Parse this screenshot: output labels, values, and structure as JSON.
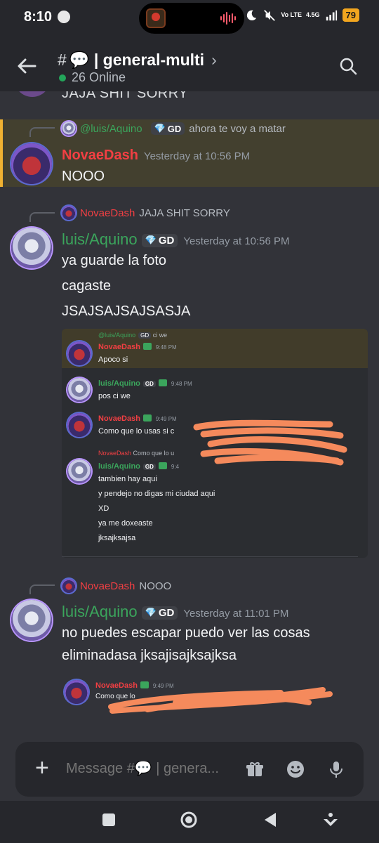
{
  "status": {
    "time": "8:10",
    "network": "4.5G",
    "lte": "Vo LTE",
    "battery": "79"
  },
  "header": {
    "channel_name": "💬 | general-multi",
    "online": "26 Online"
  },
  "cutoff_text": "JAJA SHIT SORRY",
  "messages": [
    {
      "reply_user": "@luis/Aquino",
      "reply_tag": "GD",
      "reply_text": "ahora te voy a matar",
      "author": "NovaeDash",
      "timestamp": "Yesterday at 10:56 PM",
      "lines": [
        "NOOO"
      ]
    },
    {
      "reply_user": "NovaeDash",
      "reply_text": "JAJA SHIT SORRY",
      "author": "luis/Aquino",
      "tag": "GD",
      "timestamp": "Yesterday at 10:56 PM",
      "lines": [
        "ya guarde la foto",
        "cagaste",
        "JSAJSAJSAJSASJA"
      ]
    },
    {
      "reply_user": "NovaeDash",
      "reply_text": "NOOO",
      "author": "luis/Aquino",
      "tag": "GD",
      "timestamp": "Yesterday at 11:01 PM",
      "lines": [
        "no puedes escapar puedo ver las cosas",
        "eliminadasa jksajisajksajksa"
      ]
    }
  ],
  "screenshot": {
    "m1": {
      "reply_user": "@luis/Aquino",
      "reply_tag": "GD",
      "reply_text": "ci we",
      "author": "NovaeDash",
      "time": "9:48 PM",
      "text": "Apoco si"
    },
    "m2": {
      "author": "luis/Aquino",
      "tag": "GD",
      "time": "9:48 PM",
      "text": "pos ci we"
    },
    "m3": {
      "author": "NovaeDash",
      "time": "9:49 PM",
      "text": "Como que lo usas si c"
    },
    "m4": {
      "reply_user": "NovaeDash",
      "reply_text": "Como que lo u",
      "author": "luis/Aquino",
      "tag": "GD",
      "time": "9:4",
      "lines": [
        "tambien hay aqui",
        "y pendejo no digas mi ciudad aqui",
        "XD",
        "ya me doxeaste",
        "jksajksajsa"
      ]
    }
  },
  "deleted_preview": {
    "author": "NovaeDash",
    "time": "9:49 PM",
    "text": "Como que lo"
  },
  "composer": {
    "placeholder": "Message #💬 | genera..."
  },
  "colors": {
    "background": "#323339",
    "mention": "#43402f",
    "mention_bar": "#f0b232",
    "novaedash": "#f23f43",
    "luis": "#3ba55c",
    "scribble": "#f58a5c"
  }
}
